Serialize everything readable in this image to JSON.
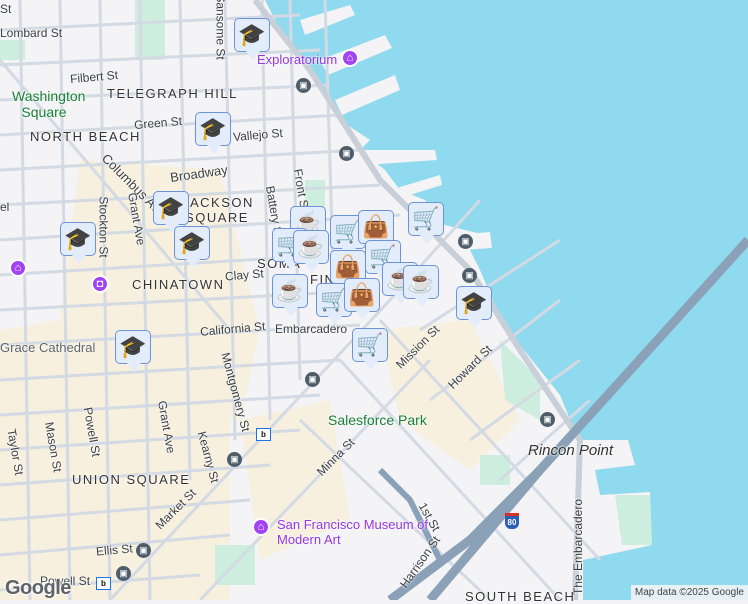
{
  "colors": {
    "water": "#8fdaee",
    "land": "#f4f3f5",
    "road": "#d3dae3",
    "highway": "#8aa1b8",
    "commercial": "#f8f0de",
    "park": "#cdeede",
    "marker_bg": "#e3ecfb",
    "marker_icon": "#0d4a6e",
    "poi": "#a142f4"
  },
  "neighborhoods": [
    "TELEGRAPH HILL",
    "NORTH BEACH",
    "JACKSON SQUARE",
    "CHINATOWN",
    "UNION SQUARE",
    "SOMA",
    "SOUTH BEACH",
    "FIN"
  ],
  "parks": [
    "Washington Square",
    "Salesforce Park"
  ],
  "pois": [
    "Exploratorium",
    "Grace Cathedral",
    "San Francisco Museum of Modern Art",
    "Embarcadero"
  ],
  "places": [
    "Rincon Point"
  ],
  "streets": [
    "St",
    "Lombard St",
    "Filbert St",
    "Green St",
    "Vallejo St",
    "Broadway",
    "Columbus Ave",
    "Stockton St",
    "Grant Ave",
    "Battery St",
    "Front St",
    "Clay St",
    "California St",
    "Montgomery St",
    "Kearny St",
    "Grant Ave",
    "Taylor St",
    "Mason St",
    "Powell St",
    "Market St",
    "Ellis St",
    "Powell St",
    "Minna St",
    "Mission St",
    "Howard St",
    "1st St",
    "Harrison St",
    "The Embarcadero",
    "Sansome St",
    "el"
  ],
  "highway_shield": "80",
  "markers": [
    {
      "type": "school",
      "icon": "graduation-cap-icon"
    },
    {
      "type": "school",
      "icon": "graduation-cap-icon"
    },
    {
      "type": "school",
      "icon": "graduation-cap-icon"
    },
    {
      "type": "school",
      "icon": "graduation-cap-icon"
    },
    {
      "type": "school",
      "icon": "graduation-cap-icon"
    },
    {
      "type": "school",
      "icon": "graduation-cap-icon"
    },
    {
      "type": "school",
      "icon": "graduation-cap-icon"
    },
    {
      "type": "cafe",
      "icon": "coffee-cup-icon"
    },
    {
      "type": "cafe",
      "icon": "coffee-cup-icon"
    },
    {
      "type": "cafe",
      "icon": "coffee-cup-icon"
    },
    {
      "type": "cafe",
      "icon": "coffee-cup-icon"
    },
    {
      "type": "cafe",
      "icon": "coffee-cup-icon"
    },
    {
      "type": "grocery",
      "icon": "shopping-cart-icon"
    },
    {
      "type": "grocery",
      "icon": "shopping-cart-icon"
    },
    {
      "type": "grocery",
      "icon": "shopping-cart-icon"
    },
    {
      "type": "grocery",
      "icon": "shopping-cart-icon"
    },
    {
      "type": "shop",
      "icon": "shopping-bag-icon"
    }
  ],
  "logo": "Google",
  "attribution": "Map data ©2025 Google"
}
